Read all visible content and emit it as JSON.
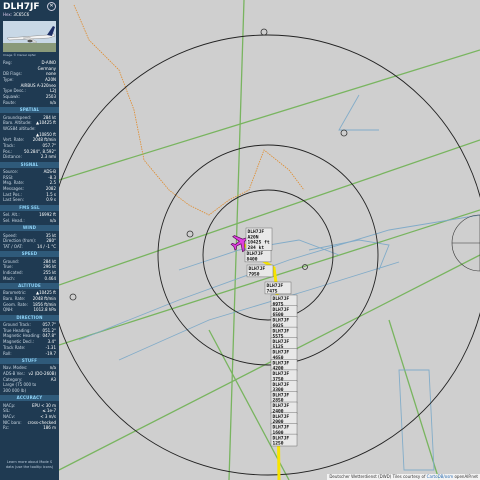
{
  "sidebar": {
    "callsign": "DLH7JF",
    "hex_label": "Hex:",
    "hex": "3C65C6",
    "photo_credit": "Image © Daniel Apfel",
    "rows_top": [
      {
        "l": "Reg:",
        "v": "D-AINO"
      },
      {
        "l": "",
        "v": "Germany"
      },
      {
        "l": "DB Flags:",
        "v": "none"
      },
      {
        "l": "Type:",
        "v": "A20N"
      },
      {
        "l": "",
        "v": "AIRBUS A-320neo"
      },
      {
        "l": "Type Desc.:",
        "v": "L2J"
      },
      {
        "l": "Squawk:",
        "v": "2503"
      },
      {
        "l": "Route:",
        "v": "n/a"
      }
    ],
    "sections": [
      {
        "title": "SPATIAL",
        "rows": [
          {
            "l": "Groundspeed:",
            "v": "284 kt"
          },
          {
            "l": "Baro. Altitude:",
            "v": "▲10425 ft"
          },
          {
            "l": "WGS84 altitude:",
            "v": ""
          },
          {
            "l": "",
            "v": "▲10850 ft"
          },
          {
            "l": "Vert. Rate:",
            "v": "2048 ft/min"
          },
          {
            "l": "Track:",
            "v": "057.7°"
          },
          {
            "l": "Pos.:",
            "v": "50.284°, 8.592°"
          },
          {
            "l": "Distance:",
            "v": "2.3 nmi"
          }
        ]
      },
      {
        "title": "SIGNAL",
        "rows": [
          {
            "l": "Source:",
            "v": "ADS-B"
          },
          {
            "l": "RSSI:",
            "v": "-8.3"
          },
          {
            "l": "Msg. Rate:",
            "v": "2.5"
          },
          {
            "l": "Messages:",
            "v": "2082"
          },
          {
            "l": "Last Pos.:",
            "v": "1.5 s"
          },
          {
            "l": "Last Seen:",
            "v": "0.9 s"
          }
        ]
      },
      {
        "title": "FMS SEL",
        "rows": [
          {
            "l": "Sel. Alt.:",
            "v": "16992 ft"
          },
          {
            "l": "Sel. Head.:",
            "v": "n/a"
          }
        ]
      },
      {
        "title": "WIND",
        "rows": [
          {
            "l": "Speed:",
            "v": "35 kt"
          },
          {
            "l": "Direction (from):",
            "v": "280°"
          },
          {
            "l": "TAT / OAT:",
            "v": "14 / -1 °C"
          }
        ]
      },
      {
        "title": "SPEED",
        "rows": [
          {
            "l": "Ground:",
            "v": "284 kt"
          },
          {
            "l": "True:",
            "v": "296 kt"
          },
          {
            "l": "Indicated:",
            "v": "255 kt"
          },
          {
            "l": "Mach:",
            "v": "0.464"
          }
        ]
      },
      {
        "title": "ALTITUDE",
        "rows": [
          {
            "l": "Barometric:",
            "v": "▲10425 ft"
          },
          {
            "l": "Baro. Rate:",
            "v": "2048 ft/min"
          },
          {
            "l": "Geom. Rate:",
            "v": "1856 ft/min"
          },
          {
            "l": "QNH:",
            "v": "1012.8 hPa"
          }
        ]
      },
      {
        "title": "DIRECTION",
        "rows": [
          {
            "l": "Ground Track:",
            "v": "057.7°"
          },
          {
            "l": "True Heading:",
            "v": "051.2°"
          },
          {
            "l": "Magnetic Heading:",
            "v": "047.8°"
          },
          {
            "l": "Magnetic Decl.:",
            "v": "3.4°"
          },
          {
            "l": "Track Rate:",
            "v": "-1.31"
          },
          {
            "l": "Roll:",
            "v": "-19.7"
          }
        ]
      },
      {
        "title": "STUFF",
        "rows": [
          {
            "l": "Nav. Modes:",
            "v": "n/a"
          },
          {
            "l": "ADS-B Ver.:",
            "v": "v2 (DO-260B)"
          },
          {
            "l": "Category:",
            "v": "A3"
          },
          {
            "l": "Large (75 000 to",
            "v": ""
          },
          {
            "l": "300 000 lb)",
            "v": ""
          }
        ]
      },
      {
        "title": "ACCURACY",
        "rows": [
          {
            "l": "NACp:",
            "v": "EPU < 30 m"
          },
          {
            "l": "SIL:",
            "v": "≤ 1e-7"
          },
          {
            "l": "NACv:",
            "v": "< 3 m/s"
          },
          {
            "l": "NIC baro:",
            "v": "cross-checked"
          },
          {
            "l": "Rc:",
            "v": "186 m"
          }
        ]
      }
    ],
    "footer_1": "Learn more about Mode S",
    "footer_2": "data (use the tooltip icons)"
  },
  "map": {
    "colors": {
      "background": "#cfcfcf",
      "range_ring": "#222222",
      "airway": "#6ab04c",
      "airspace": "#7aa8c8",
      "border": "#e08a2a",
      "trail": "#f7e400",
      "aircraft": "#e040e0",
      "label_bg": "#e8e8e8"
    },
    "aircraft_labels": [
      "DLH7JF",
      "A20N",
      "10425 ft",
      "284 kt"
    ],
    "track_labels": [
      {
        "callsign": "DLH7JF",
        "alt": "8400"
      },
      {
        "callsign": "DLH7JF",
        "alt": "7950"
      },
      {
        "callsign": "DLH7JF",
        "alt": "7475"
      },
      {
        "callsign": "DLH7JF",
        "alt": "6975"
      },
      {
        "callsign": "DLH7JF",
        "alt": "6500"
      },
      {
        "callsign": "DLH7JF",
        "alt": "6025"
      },
      {
        "callsign": "DLH7JF",
        "alt": "5575"
      },
      {
        "callsign": "DLH7JF",
        "alt": "5125"
      },
      {
        "callsign": "DLH7JF",
        "alt": "4650"
      },
      {
        "callsign": "DLH7JF",
        "alt": "4200"
      },
      {
        "callsign": "DLH7JF",
        "alt": "3750"
      },
      {
        "callsign": "DLH7JF",
        "alt": "3300"
      },
      {
        "callsign": "DLH7JF",
        "alt": "2850"
      },
      {
        "callsign": "DLH7JF",
        "alt": "2400"
      },
      {
        "callsign": "DLH7JF",
        "alt": "2000"
      },
      {
        "callsign": "DLH7JF",
        "alt": "1600"
      },
      {
        "callsign": "DLH7JF",
        "alt": "1250"
      }
    ],
    "attribution_prefix": "Deutscher Wetterdienst (DWD) Tiles courtesy of",
    "attribution_link": "CartoDB/osm",
    "attribution_suffix": "openAIP.net"
  }
}
